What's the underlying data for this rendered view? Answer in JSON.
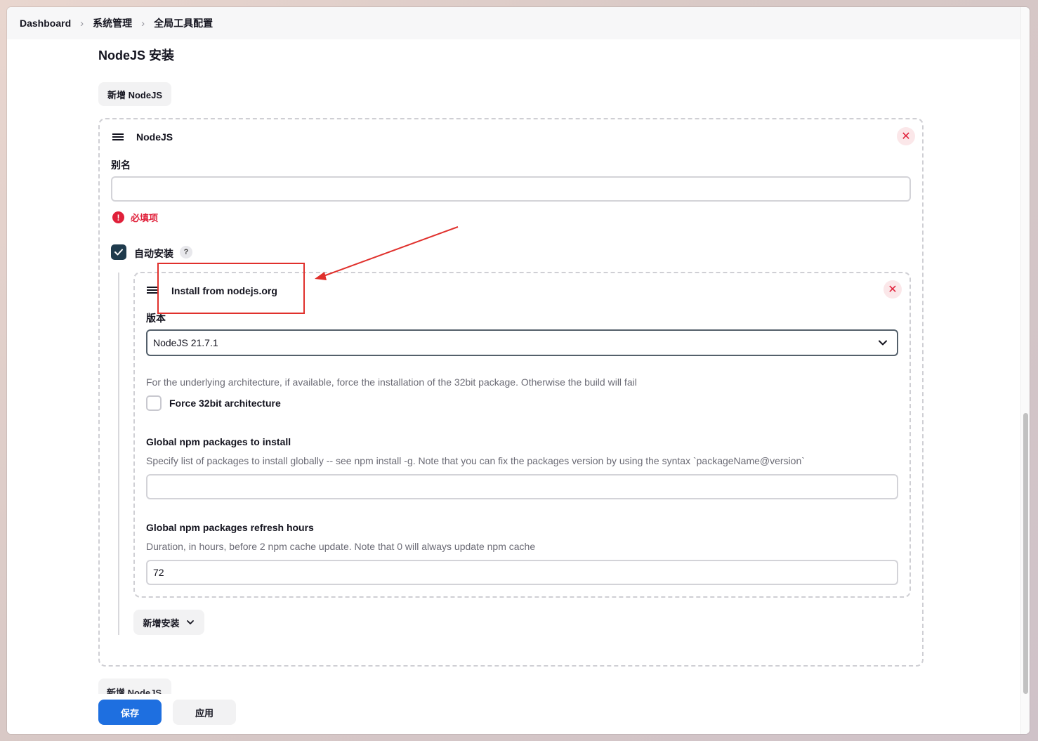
{
  "breadcrumb": [
    "Dashboard",
    "系统管理",
    "全局工具配置"
  ],
  "section_title": "NodeJS 安装",
  "add_nodejs_label": "新增 NodeJS",
  "tool_card": {
    "title": "NodeJS",
    "alias_label": "别名",
    "alias_value": "",
    "required_error": "必填项",
    "auto_install_label": "自动安装",
    "auto_install_checked": true,
    "help_label": "?"
  },
  "installer": {
    "title": "Install from nodejs.org",
    "version_label": "版本",
    "version_value": "NodeJS 21.7.1",
    "force32_desc": "For the underlying architecture, if available, force the installation of the 32bit package. Otherwise the build will fail",
    "force32_label": "Force 32bit architecture",
    "force32_checked": false,
    "npm_packages_label": "Global npm packages to install",
    "npm_packages_desc": "Specify list of packages to install globally -- see npm install -g. Note that you can fix the packages version by using the syntax `packageName@version`",
    "npm_packages_value": "",
    "refresh_label": "Global npm packages refresh hours",
    "refresh_desc": "Duration, in hours, before 2 npm cache update. Note that 0 will always update npm cache",
    "refresh_value": "72"
  },
  "add_installer_label": "新增安装",
  "footer": {
    "ghost_label": "新增 NodeJS",
    "save_label": "保存",
    "apply_label": "应用"
  },
  "colors": {
    "primary": "#1e6fe0",
    "error": "#e0203a",
    "annotation": "#e0302c",
    "checkbox_checked": "#1f3b4d"
  }
}
